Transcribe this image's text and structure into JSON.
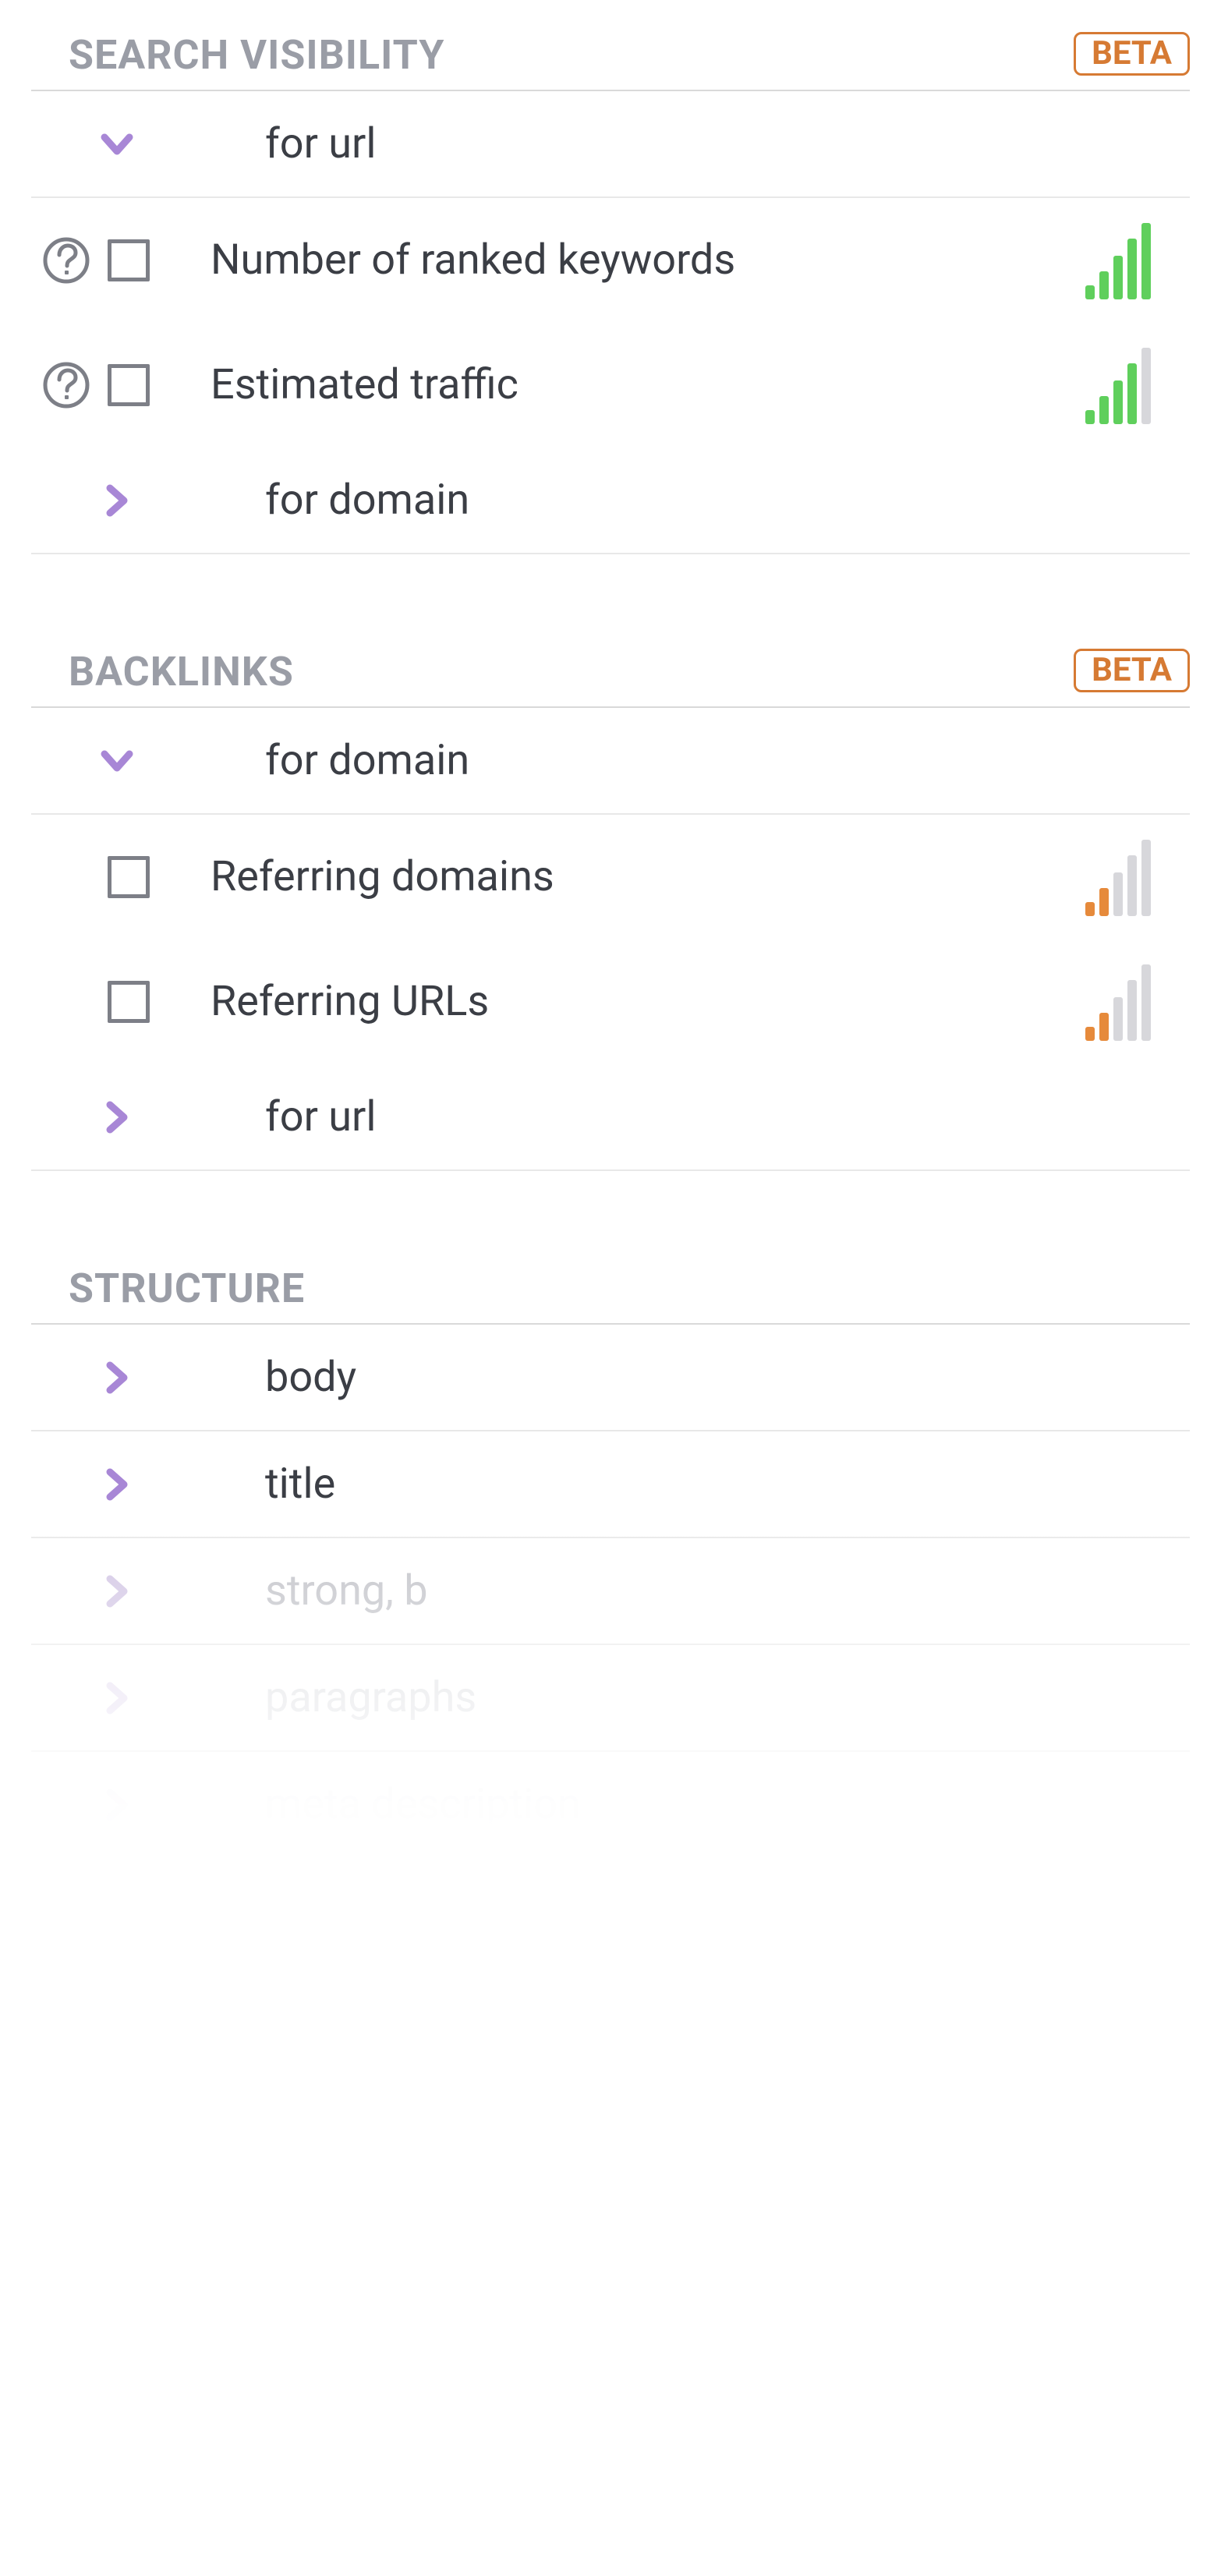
{
  "badges": {
    "beta": "BETA"
  },
  "sections": {
    "search_visibility": {
      "title": "SEARCH VISIBILITY",
      "for_url": {
        "label": "for url"
      },
      "for_domain": {
        "label": "for domain"
      },
      "metrics": {
        "ranked_keywords": {
          "label": "Number of ranked keywords",
          "signal_filled": 5,
          "signal_color": "green"
        },
        "estimated_traffic": {
          "label": "Estimated traffic",
          "signal_filled": 4,
          "signal_color": "green"
        }
      }
    },
    "backlinks": {
      "title": "BACKLINKS",
      "for_domain": {
        "label": "for domain"
      },
      "for_url": {
        "label": "for url"
      },
      "metrics": {
        "referring_domains": {
          "label": "Referring domains",
          "signal_filled": 2,
          "signal_color": "orange"
        },
        "referring_urls": {
          "label": "Referring URLs",
          "signal_filled": 2,
          "signal_color": "orange"
        }
      }
    },
    "structure": {
      "title": "STRUCTURE",
      "items": {
        "body": {
          "label": "body"
        },
        "title": {
          "label": "title"
        },
        "strong_b": {
          "label": "strong, b"
        },
        "paragraphs": {
          "label": "paragraphs"
        },
        "meta_description": {
          "label": "meta description"
        }
      }
    }
  }
}
